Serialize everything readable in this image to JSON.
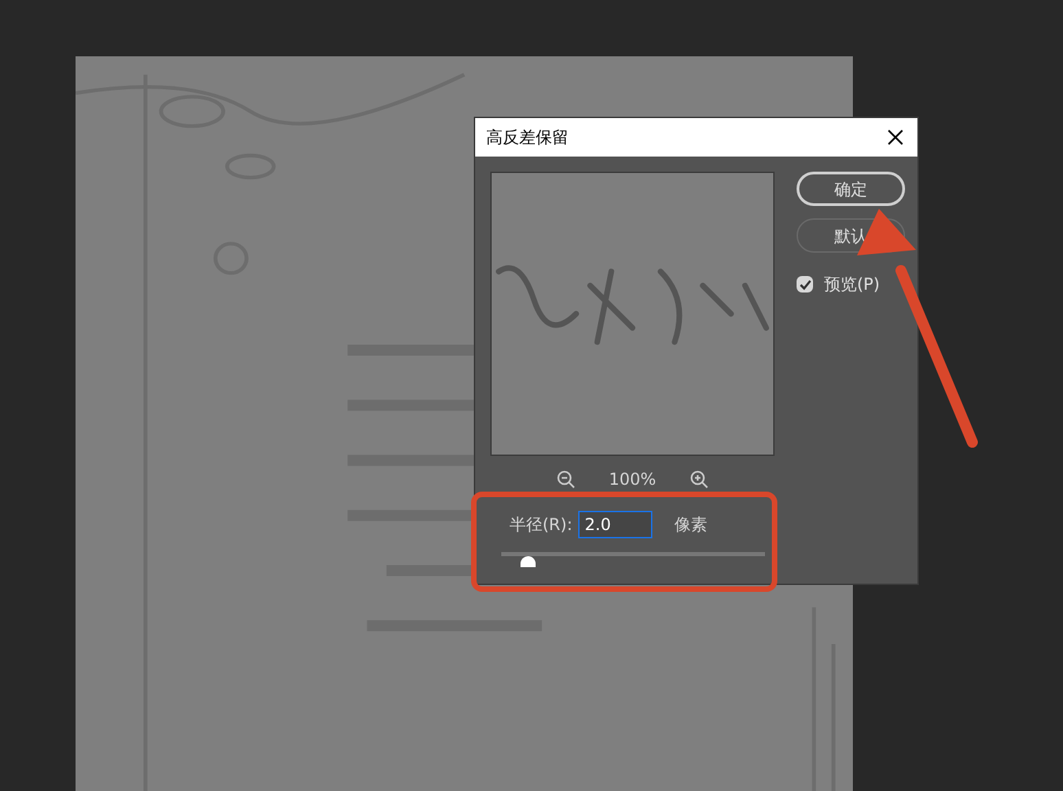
{
  "dialog": {
    "title": "高反差保留",
    "preview": {
      "kind": "picture",
      "zoom": "100%"
    },
    "buttons": [
      {
        "label": "确定",
        "selected": true
      },
      {
        "label": "默认",
        "selected": false
      }
    ],
    "preview_checkbox": {
      "label": "预览(P)",
      "checked": true
    },
    "radius": {
      "label": "半径(R):",
      "value": "2.0",
      "unit": "像素",
      "level": 0.1
    }
  }
}
